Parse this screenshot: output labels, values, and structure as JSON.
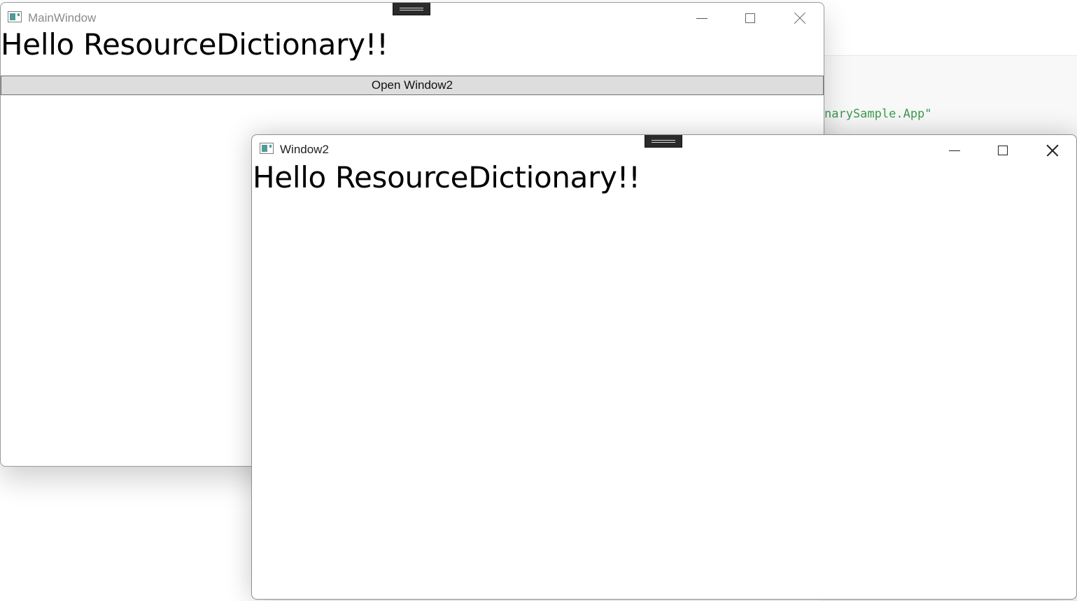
{
  "background": {
    "code_line": "narySample.App\"",
    "code_color": "#3d9a4e"
  },
  "main_window": {
    "title": "MainWindow",
    "heading": "Hello ResourceDictionary!!",
    "open_button_label": "Open Window2"
  },
  "window2": {
    "title": "Window2",
    "heading": "Hello ResourceDictionary!!"
  },
  "icons": {
    "app": "app-window-icon",
    "minimize": "minimize-icon",
    "maximize": "maximize-icon",
    "close": "close-icon",
    "grip": "drag-grip-icon"
  }
}
